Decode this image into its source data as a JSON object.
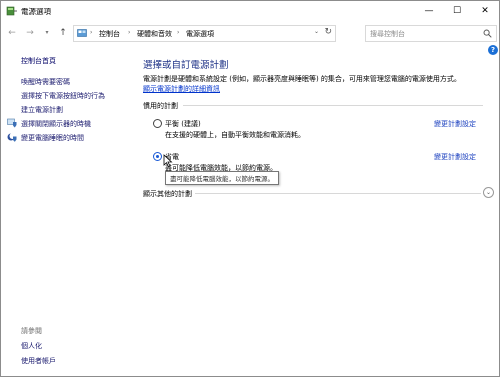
{
  "window": {
    "title": "電源選項",
    "minimize": "—",
    "maximize": "☐",
    "close": "✕"
  },
  "address": {
    "crumbs": [
      "控制台",
      "硬體和音效",
      "電源選項"
    ],
    "search_placeholder": "搜尋控制台"
  },
  "sidebar": {
    "home": "控制台首頁",
    "links": [
      "喚醒時需要密碼",
      "選擇按下電源按鈕時的行為",
      "建立電源計劃",
      "選擇關閉顯示器的時機",
      "變更電腦睡眠的時間"
    ],
    "see_also": "請參閱",
    "see_also_links": [
      "個人化",
      "使用者帳戶"
    ]
  },
  "main": {
    "title": "選擇或自訂電源計劃",
    "description": "電源計劃是硬體和系統設定 (例如，顯示器亮度與睡眠等) 的集合，可用來管理您電腦的電源使用方式。",
    "description_link": "顯示電源計劃的詳細資訊",
    "preferred_label": "慣用的計劃",
    "plans": [
      {
        "name": "平衡 (建議)",
        "description": "在支援的硬體上，自動平衡效能和電源消耗。",
        "link": "變更計劃設定",
        "selected": false
      },
      {
        "name": "省電",
        "description": "盡可能降低電腦效能，以節約電源。",
        "link": "變更計劃設定",
        "selected": true
      }
    ],
    "tooltip": "盡可能降低電腦效能，以節約電源。",
    "more_plans_label": "顯示其他的計劃"
  },
  "colors": {
    "title_blue": "#1e3287",
    "link_blue": "#1a3fbf",
    "radio_blue": "#1a5ad6"
  }
}
